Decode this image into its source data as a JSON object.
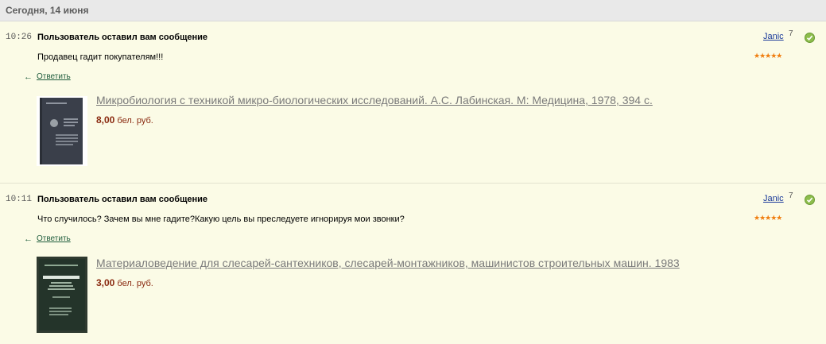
{
  "header": {
    "date": "Сегодня, 14 июня"
  },
  "messages": [
    {
      "time": "10:26",
      "subject": "Пользователь оставил вам сообщение",
      "text": "Продавец гадит покупателям!!!",
      "reply_label": "Ответить",
      "user": "Janic",
      "user_rating": "7",
      "stars": "★★★★★",
      "book_title": "Микробиология с техникой микро-биологических исследований. А.С. Лабинская. М: Медицина, 1978, 394 с.",
      "price_value": "8,00",
      "price_currency": "бел. руб."
    },
    {
      "time": "10:11",
      "subject": "Пользователь оставил вам сообщение",
      "text": "Что случилось? Зачем вы мне гадите?Какую цель вы преследуете игнорируя мои звонки?",
      "reply_label": "Ответить",
      "user": "Janic",
      "user_rating": "7",
      "stars": "★★★★★",
      "book_title": "Материаловедение для слесарей-сантехников, слесарей-монтажников, машинистов строительных машин. 1983",
      "price_value": "3,00",
      "price_currency": "бел. руб."
    }
  ],
  "colors": {
    "background": "#fbfbe6",
    "header_bg": "#e9e9e9",
    "link": "#1a3a9a",
    "reply_link": "#1f5c3c",
    "price": "#8a2a10",
    "stars": "#f07e10",
    "verified": "#8dbd4c"
  },
  "icons": {
    "reply": "reply-arrow-icon",
    "verified": "verified-check-icon",
    "star": "star-icon"
  }
}
